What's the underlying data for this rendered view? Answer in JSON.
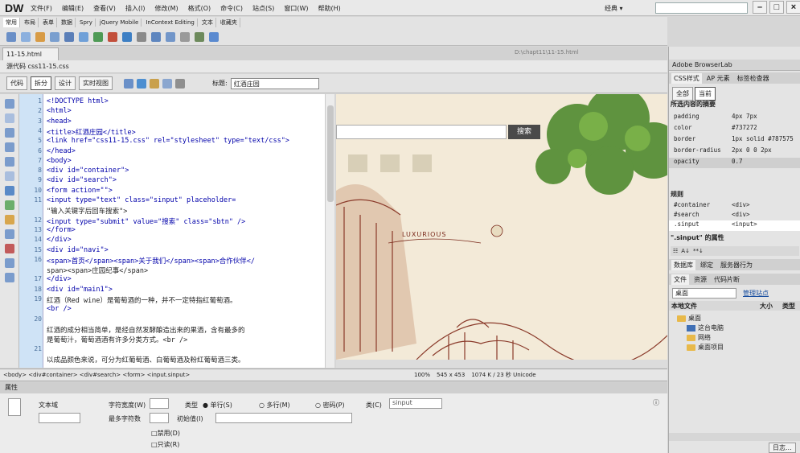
{
  "app": {
    "logo": "DW",
    "menus": [
      "文件(F)",
      "编辑(E)",
      "查看(V)",
      "插入(I)",
      "修改(M)",
      "格式(O)",
      "命令(C)",
      "站点(S)",
      "窗口(W)",
      "帮助(H)"
    ],
    "workspace": "经典 ▾"
  },
  "insert_tabs": [
    "常用",
    "布局",
    "表单",
    "数据",
    "Spry",
    "jQuery Mobile",
    "InContext Editing",
    "文本",
    "收藏夹"
  ],
  "doc": {
    "tab": "11-15.html",
    "path": "D:\\chapt11\\11-15.html",
    "related": "源代码  css11-15.css"
  },
  "views": {
    "code": "代码",
    "split": "拆分",
    "design": "设计",
    "live": "实时视图",
    "title_label": "标题:",
    "title_value": "红酒庄园"
  },
  "code_lines": [
    {
      "n": "1",
      "t": "<!DOCTYPE html>"
    },
    {
      "n": "2",
      "t": "<html>"
    },
    {
      "n": "3",
      "t": "<head>"
    },
    {
      "n": "4",
      "t": "<title>红酒庄园</title>"
    },
    {
      "n": "5",
      "t": "<link href=\"css11-15.css\" rel=\"stylesheet\" type=\"text/css\">"
    },
    {
      "n": "6",
      "t": "</head>"
    },
    {
      "n": "7",
      "t": "<body>"
    },
    {
      "n": "8",
      "t": "<div id=\"container\">"
    },
    {
      "n": "9",
      "t": "    <div id=\"search\">"
    },
    {
      "n": "10",
      "t": "    <form action=\"\">"
    },
    {
      "n": "11",
      "t": "        <input type=\"text\" class=\"sinput\" placeholder="
    },
    {
      "n": "",
      "t": "\"输入关键字后回车搜索\">"
    },
    {
      "n": "12",
      "t": "        <input type=\"submit\" value=\"搜索\" class=\"sbtn\" />"
    },
    {
      "n": "13",
      "t": "    </form>"
    },
    {
      "n": "14",
      "t": "    </div>"
    },
    {
      "n": "15",
      "t": "    <div id=\"navi\">"
    },
    {
      "n": "16",
      "t": "    <span>首页</span><span>关于我们</span><span>合作伙伴</"
    },
    {
      "n": "",
      "t": "span><span>庄园纪事</span>"
    },
    {
      "n": "17",
      "t": "    </div>"
    },
    {
      "n": "18",
      "t": "    <div id=\"main1\">"
    },
    {
      "n": "19",
      "t": "    红酒（Red wine）是葡萄酒的一种，并不一定特指红葡萄酒。"
    },
    {
      "n": "",
      "t": "<br />"
    },
    {
      "n": "20",
      "t": ""
    },
    {
      "n": "",
      "t": "红酒的成分相当简单，是经自然发酵酿造出来的果酒，含有最多的"
    },
    {
      "n": "",
      "t": "是葡萄汁，葡萄酒酒有许多分类方式。<br />"
    },
    {
      "n": "21",
      "t": ""
    },
    {
      "n": "",
      "t": "以成品颜色来说，可分为红葡萄酒、白葡萄酒及粉红葡萄酒三类。"
    }
  ],
  "design": {
    "search_button": "搜索",
    "luxurious": "LUXURIOUS"
  },
  "status": {
    "tags": "<body> <div#container> <div#search> <form> <input.sinput>",
    "zoom": "100%",
    "size": "545 x 453",
    "file": "1074 K / 23 秒 Unicode"
  },
  "properties": {
    "title": "属性",
    "label_textfield": "文本域",
    "char_width": "字符宽度(W)",
    "max_chars": "最多字符数",
    "type": "类型",
    "single": "单行(S)",
    "multi": "多行(M)",
    "password": "密码(P)",
    "class_label": "类(C)",
    "class_value": "sinput",
    "init_value": "初始值(I)",
    "disabled": "禁用(D)",
    "readonly": "只读(R)"
  },
  "right": {
    "browserlab": "Adobe BrowserLab",
    "css_tabs": [
      "CSS样式",
      "AP 元素",
      "标签检查器"
    ],
    "scope_tabs": [
      "全部",
      "当前"
    ],
    "summary_title": "所选内容的摘要",
    "summary": [
      {
        "k": "padding",
        "v": "4px 7px"
      },
      {
        "k": "color",
        "v": "#737272"
      },
      {
        "k": "border",
        "v": "1px solid #787575"
      },
      {
        "k": "border-radius",
        "v": "2px 0 0 2px"
      },
      {
        "k": "opacity",
        "v": "0.7"
      }
    ],
    "rules_title": "规则",
    "rules": [
      {
        "k": "#container",
        "v": "<div>"
      },
      {
        "k": "#search",
        "v": "<div>"
      },
      {
        "k": ".sinput",
        "v": "<input>"
      }
    ],
    "prop_title": "\".sinput\" 的属性",
    "db_tabs": [
      "数据库",
      "绑定",
      "服务器行为"
    ],
    "file_tabs": [
      "文件",
      "资源",
      "代码片断"
    ],
    "site_select": "桌面",
    "manage_link": "管理站点",
    "local_files": "本地文件",
    "col_size": "大小",
    "col_type": "类型",
    "tree": [
      "桌面",
      "这台电脑",
      "网络",
      "桌面项目"
    ],
    "log": "日志..."
  },
  "colors": {
    "gutter": "#cfe3f6",
    "code_tag": "#0000aa",
    "accent": "#3f6fb5"
  }
}
